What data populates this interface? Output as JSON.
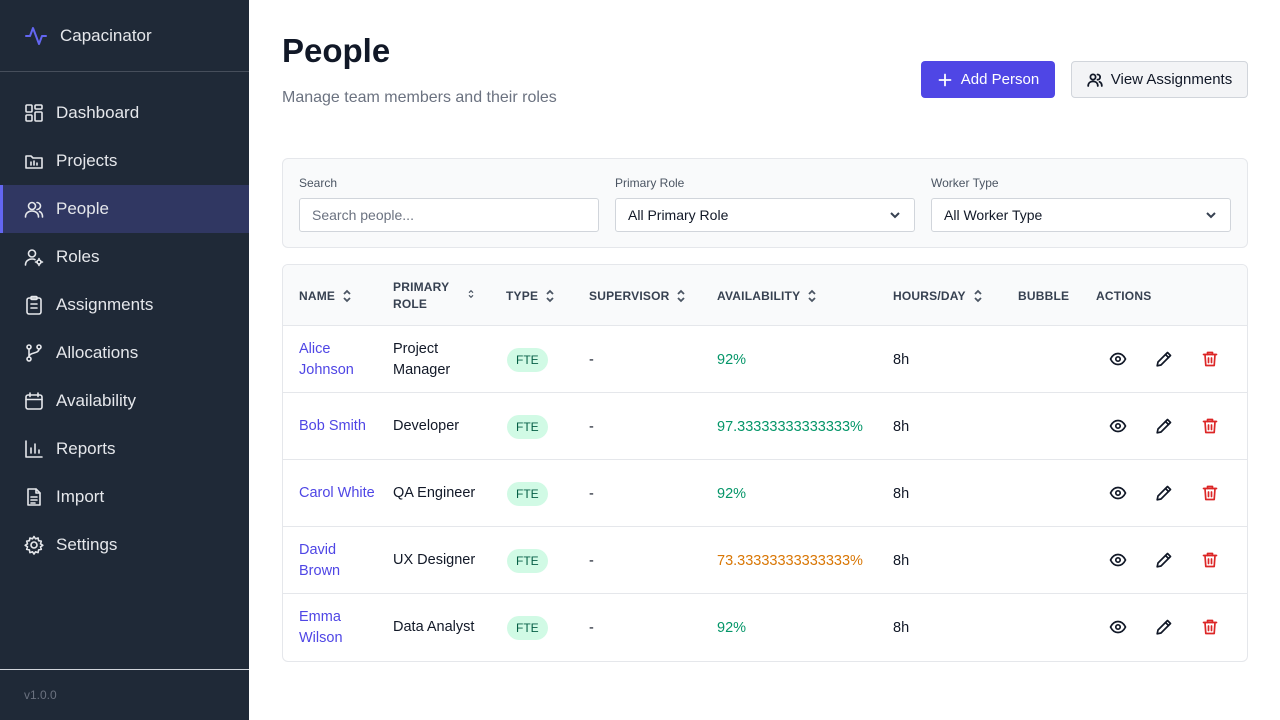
{
  "app": {
    "name": "Capacinator",
    "version": "v1.0.0"
  },
  "sidebar": {
    "items": [
      {
        "label": "Dashboard",
        "icon": "dashboard-icon"
      },
      {
        "label": "Projects",
        "icon": "projects-icon"
      },
      {
        "label": "People",
        "icon": "people-icon",
        "active": true
      },
      {
        "label": "Roles",
        "icon": "roles-icon"
      },
      {
        "label": "Assignments",
        "icon": "assignments-icon"
      },
      {
        "label": "Allocations",
        "icon": "allocations-icon"
      },
      {
        "label": "Availability",
        "icon": "calendar-icon"
      },
      {
        "label": "Reports",
        "icon": "reports-icon"
      },
      {
        "label": "Import",
        "icon": "import-icon"
      },
      {
        "label": "Settings",
        "icon": "settings-icon"
      }
    ]
  },
  "header": {
    "title": "People",
    "subtitle": "Manage team members and their roles",
    "add_button": "Add Person",
    "view_button": "View Assignments"
  },
  "filters": {
    "search_label": "Search",
    "search_placeholder": "Search people...",
    "role_label": "Primary Role",
    "role_value": "All Primary Role",
    "type_label": "Worker Type",
    "type_value": "All Worker Type"
  },
  "table": {
    "columns": [
      "NAME",
      "PRIMARY ROLE",
      "TYPE",
      "SUPERVISOR",
      "AVAILABILITY",
      "HOURS/DAY",
      "BUBBLE",
      "ACTIONS"
    ],
    "rows": [
      {
        "name": "Alice Johnson",
        "role": "Project Manager",
        "type": "FTE",
        "supervisor": "-",
        "availability": "92%",
        "status": "green",
        "hours": "8h"
      },
      {
        "name": "Bob Smith",
        "role": "Developer",
        "type": "FTE",
        "supervisor": "-",
        "availability": "97.33333333333333%",
        "status": "green",
        "hours": "8h"
      },
      {
        "name": "Carol White",
        "role": "QA Engineer",
        "type": "FTE",
        "supervisor": "-",
        "availability": "92%",
        "status": "green",
        "hours": "8h"
      },
      {
        "name": "David Brown",
        "role": "UX Designer",
        "type": "FTE",
        "supervisor": "-",
        "availability": "73.33333333333333%",
        "status": "orange",
        "hours": "8h"
      },
      {
        "name": "Emma Wilson",
        "role": "Data Analyst",
        "type": "FTE",
        "supervisor": "-",
        "availability": "92%",
        "status": "green",
        "hours": "8h"
      }
    ]
  },
  "colors": {
    "sidebar_bg": "#1f2937",
    "accent": "#4f46e5",
    "available_green": "#059669",
    "warning_orange": "#d97706",
    "delete_red": "#dc2626"
  }
}
